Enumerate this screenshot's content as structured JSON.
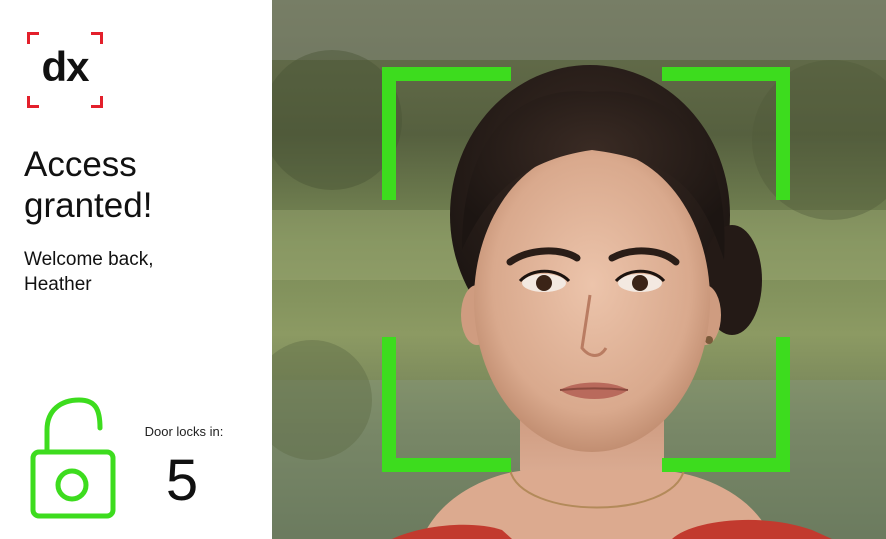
{
  "brand": {
    "logo_text": "dx",
    "accent_color": "#e3202b"
  },
  "status": {
    "heading": "Access granted!",
    "welcome_line1": "Welcome back,",
    "welcome_line2": "Heather"
  },
  "door": {
    "lock_state_icon": "unlocked-padlock-icon",
    "countdown_label": "Door locks in:",
    "countdown_value": "5"
  },
  "camera": {
    "face_frame_color": "#3ddc1e",
    "frame_icon": "face-detection-frame-icon"
  }
}
